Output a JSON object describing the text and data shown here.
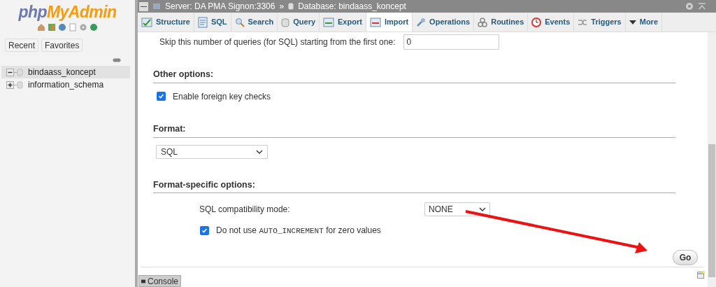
{
  "sidebar": {
    "logo": {
      "first": "php",
      "second": "MyAdmin"
    },
    "quick_links": [
      "Recent",
      "Favorites"
    ],
    "databases": [
      {
        "name": "bindaass_koncept",
        "expanded": true,
        "selected": true
      },
      {
        "name": "information_schema",
        "expanded": false,
        "selected": false
      }
    ]
  },
  "breadcrumb": {
    "server": "Server: DA PMA Signon:3306",
    "separator": "»",
    "database": "Database: bindaass_koncept"
  },
  "tabs": [
    {
      "label": "Structure",
      "kind": "structure",
      "selected": false
    },
    {
      "label": "SQL",
      "kind": "sql",
      "selected": false
    },
    {
      "label": "Search",
      "kind": "search",
      "selected": false
    },
    {
      "label": "Query",
      "kind": "query",
      "selected": false
    },
    {
      "label": "Export",
      "kind": "export",
      "selected": false
    },
    {
      "label": "Import",
      "kind": "import",
      "selected": true
    },
    {
      "label": "Operations",
      "kind": "operations",
      "selected": false
    },
    {
      "label": "Routines",
      "kind": "routines",
      "selected": false
    },
    {
      "label": "Events",
      "kind": "events",
      "selected": false
    },
    {
      "label": "Triggers",
      "kind": "triggers",
      "selected": false
    },
    {
      "label": "More",
      "kind": "more",
      "selected": false
    }
  ],
  "skip": {
    "label": "Skip this number of queries (for SQL) starting from the first one:",
    "value": "0"
  },
  "other_options": {
    "heading": "Other options:",
    "foreign_key": {
      "label": "Enable foreign key checks",
      "checked": true
    }
  },
  "format": {
    "heading": "Format:",
    "value": "SQL"
  },
  "format_specific": {
    "heading": "Format-specific options:",
    "compat_label": "SQL compatibility mode:",
    "compat_value": "NONE",
    "auto_increment": {
      "label_before": "Do not use",
      "label_code": "AUTO_INCREMENT",
      "label_after": "for zero values",
      "checked": true
    }
  },
  "go_button": "Go",
  "console": "Console"
}
